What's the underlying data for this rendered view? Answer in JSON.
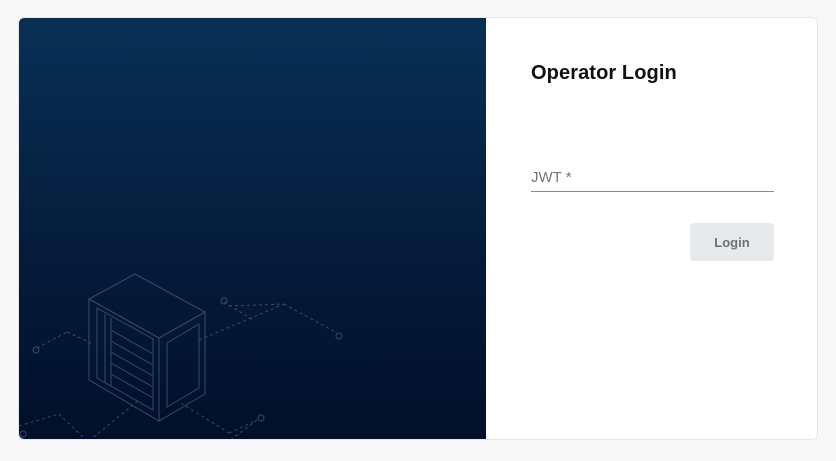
{
  "login": {
    "title": "Operator Login",
    "jwt_label": "JWT *",
    "jwt_value": "",
    "login_label": "Login"
  },
  "colors": {
    "hero_top": "#083056",
    "hero_bottom": "#020f2a",
    "button_bg": "#e6eaec",
    "button_text": "#6d7275"
  },
  "illustration": {
    "icon": "server-rack-icon"
  }
}
